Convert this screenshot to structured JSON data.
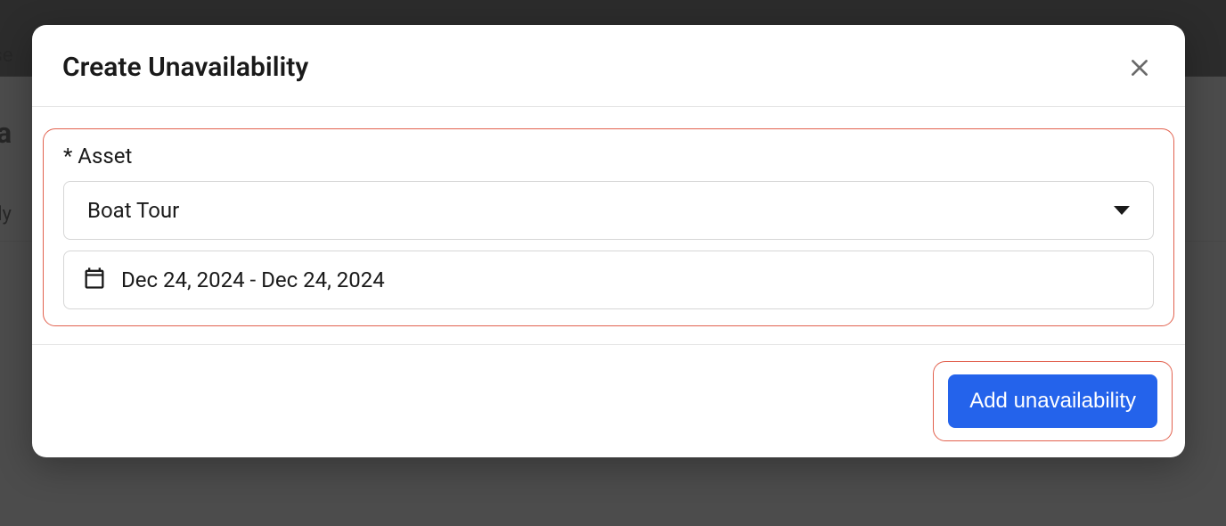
{
  "background": {
    "partial_text_1": "sse",
    "partial_title": "va",
    "partial_tab": "tly"
  },
  "modal": {
    "title": "Create Unavailability",
    "asset": {
      "label": "* Asset",
      "selected": "Boat Tour"
    },
    "date_range": {
      "value": "Dec 24, 2024 - Dec 24, 2024"
    },
    "submit_label": "Add unavailability"
  }
}
